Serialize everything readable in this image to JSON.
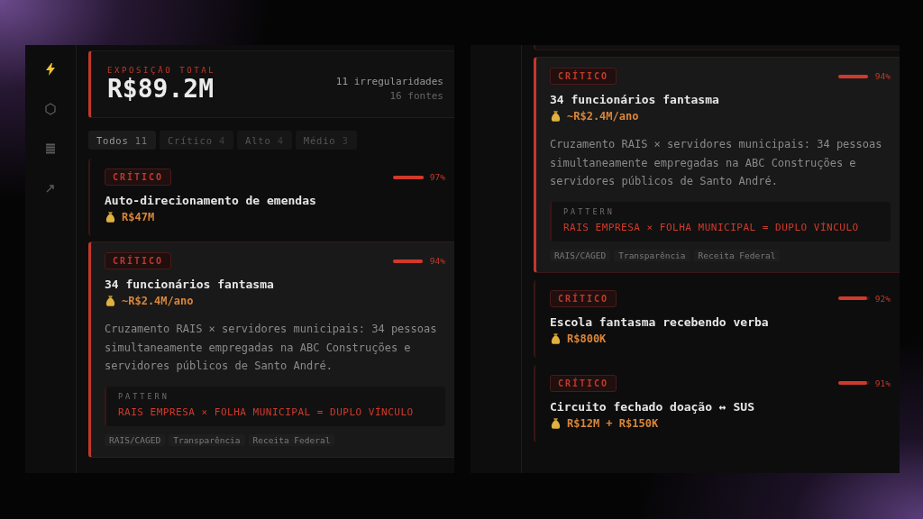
{
  "panels": [
    {
      "kind": "dashboard",
      "sidebar": [
        {
          "selected": true
        },
        {
          "selected": false
        },
        {
          "selected": false
        },
        {
          "selected": false
        }
      ],
      "summary": {
        "label": "EXPOSIÇÃO TOTAL",
        "value": "R$89.2M",
        "count": "11 irregularidades",
        "sources": "16 fontes"
      },
      "filters": [
        {
          "label": "Todos",
          "count": "11",
          "selected": true
        },
        {
          "label": "Crítico",
          "count": "4",
          "selected": false
        },
        {
          "label": "Alto",
          "count": "4",
          "selected": false
        },
        {
          "label": "Médio",
          "count": "3",
          "selected": false
        }
      ],
      "findings": [
        {
          "severity": "CRÍTICO",
          "level": 0.97,
          "percent": "97%",
          "title": "Auto-direcionamento de emendas",
          "amount": "R$47M",
          "expanded": false
        },
        {
          "severity": "CRÍTICO",
          "level": 0.94,
          "percent": "94%",
          "title": "34 funcionários fantasma",
          "amount": "~R$2.4M/ano",
          "expanded": true,
          "description": "Cruzamento RAIS × servidores municipais: 34 pessoas simultaneamente empregadas na ABC Construções e servidores públicos de Santo André.",
          "pattern_label": "PATTERN",
          "pattern": "RAIS EMPRESA × FOLHA MUNICIPAL = DUPLO VÍNCULO",
          "sources": [
            "RAIS/CAGED",
            "Transparência",
            "Receita Federal"
          ]
        }
      ]
    },
    {
      "kind": "detail",
      "findings": [
        {
          "severity": "CRÍTICO",
          "level": 0.94,
          "percent": "94%",
          "title": "34 funcionários fantasma",
          "amount": "~R$2.4M/ano",
          "expanded": true,
          "description": "Cruzamento RAIS × servidores municipais: 34 pessoas simultaneamente empregadas na ABC Construções e servidores públicos de Santo André.",
          "pattern_label": "PATTERN",
          "pattern": "RAIS EMPRESA × FOLHA MUNICIPAL = DUPLO VÍNCULO",
          "sources": [
            "RAIS/CAGED",
            "Transparência",
            "Receita Federal"
          ]
        },
        {
          "severity": "CRÍTICO",
          "level": 0.92,
          "percent": "92%",
          "title": "Escola fantasma recebendo verba",
          "amount": "R$800K",
          "expanded": false
        },
        {
          "severity": "CRÍTICO",
          "level": 0.91,
          "percent": "91%",
          "title": "Circuito fechado doação ↔ SUS",
          "amount": "R$12M + R$150K",
          "expanded": false
        }
      ]
    }
  ]
}
